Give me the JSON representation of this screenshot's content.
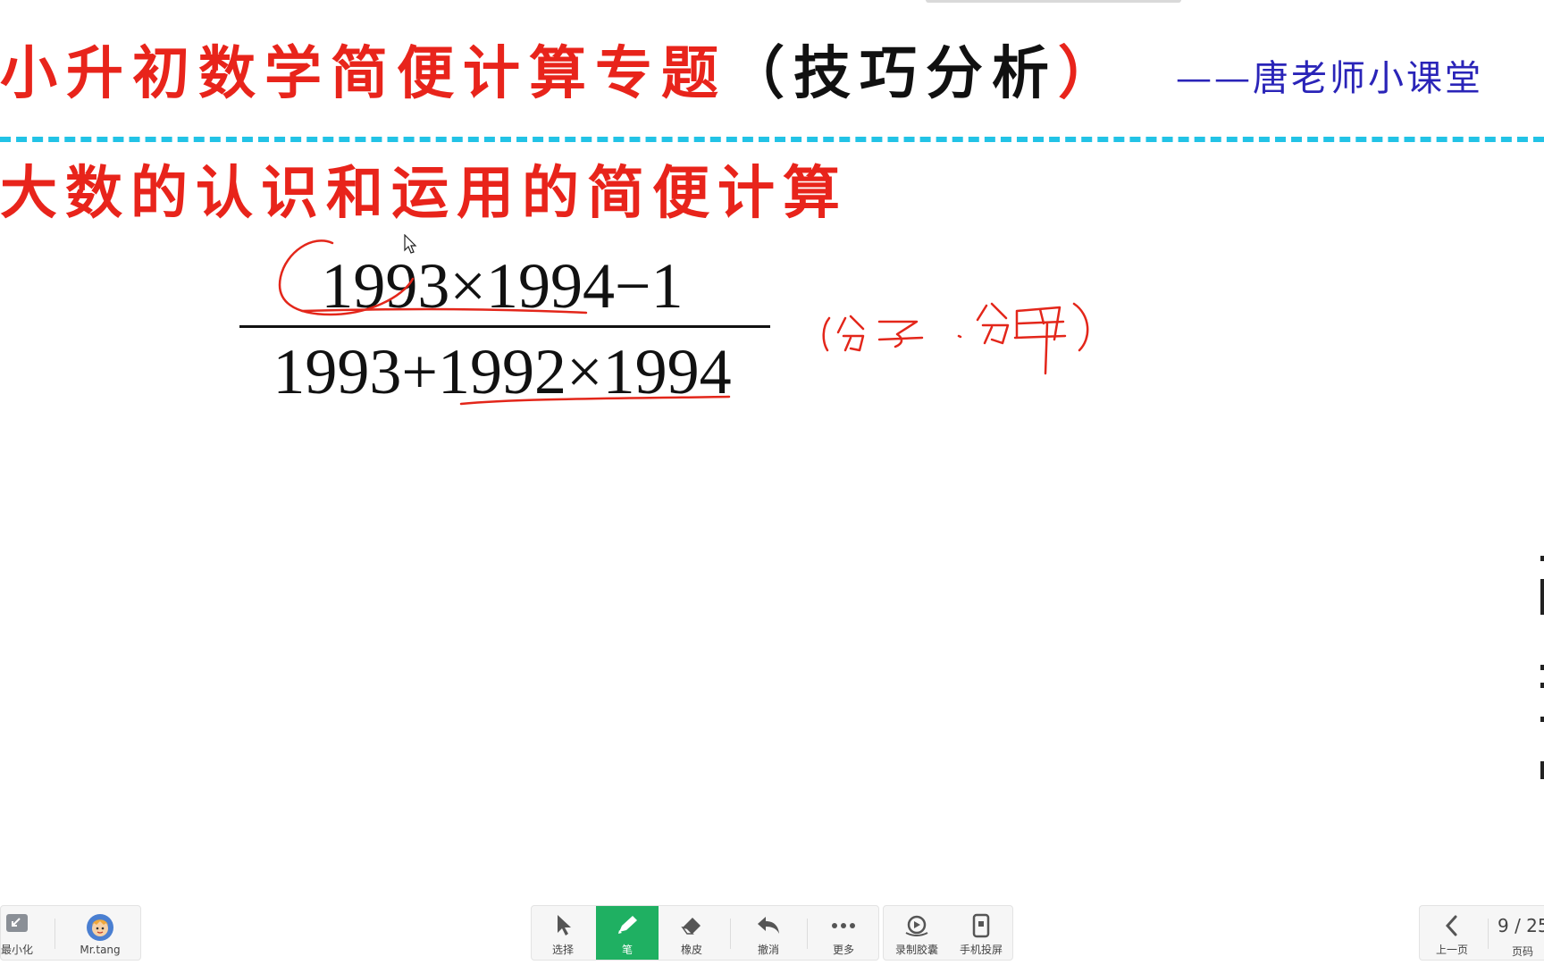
{
  "slide": {
    "title_red": "小升初数学简便计算专题",
    "title_black": "（技巧分析",
    "title_close": "）",
    "author": "——唐老师小课堂",
    "section_title": "大数的认识和运用的简便计算",
    "numerator": "1993×1994−1",
    "denominator": "1993+1992×1994"
  },
  "bottom_left": {
    "minimize_label": "最小化",
    "user_name": "Mr.tang"
  },
  "toolbar": {
    "select_label": "选择",
    "pen_label": "笔",
    "eraser_label": "橡皮",
    "undo_label": "撤消",
    "more_label": "更多",
    "record_label": "录制胶囊",
    "phone_label": "手机投屏"
  },
  "pager": {
    "prev_label": "上一页",
    "page_text": "9 / 25",
    "page_label": "页码"
  },
  "colors": {
    "title_red": "#e8241b",
    "author_blue": "#2a24b8",
    "divider_cyan": "#22c3e6",
    "pen_active_green": "#1fb062",
    "ink_red": "#e3261a"
  },
  "icons": [
    "minimize-icon",
    "avatar-icon",
    "cursor-arrow-icon",
    "pen-icon",
    "eraser-icon",
    "undo-icon",
    "more-dots-icon",
    "record-capsule-icon",
    "phone-cast-icon",
    "chevron-left-icon"
  ]
}
